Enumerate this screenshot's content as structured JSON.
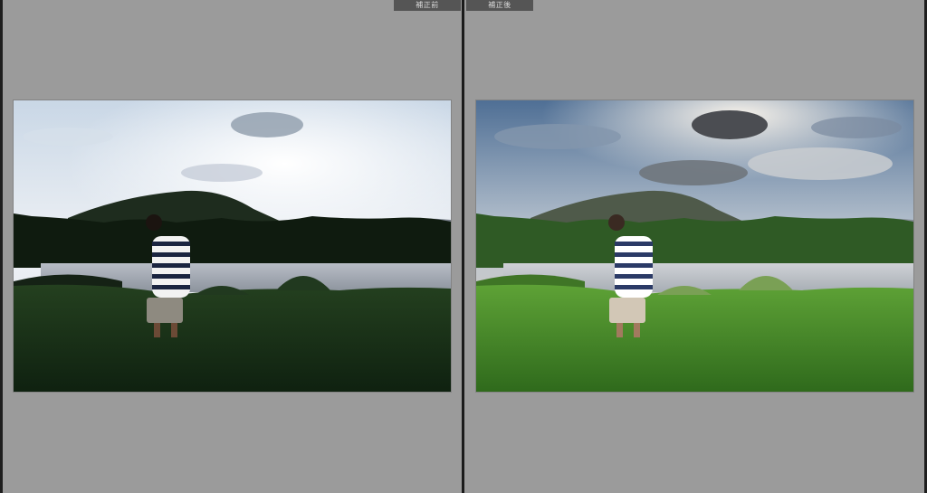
{
  "window": {
    "before_label": "補正前",
    "after_label": "補正後"
  },
  "panes": [
    {
      "name": "before",
      "image": "photo-boy-by-river-original"
    },
    {
      "name": "after",
      "image": "photo-boy-by-river-corrected"
    }
  ],
  "colors": {
    "background": "#9b9b9b",
    "divider": "#1b1b1b",
    "label_bg": "#555555",
    "label_text": "#d8d8d8"
  }
}
